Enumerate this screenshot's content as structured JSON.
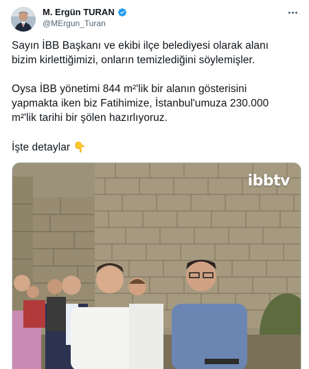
{
  "author": {
    "display_name": "M. Ergün TURAN",
    "handle": "@MErgun_Turan",
    "verified": true,
    "avatar_icon": "avatar-photo"
  },
  "tweet": {
    "line1": "Sayın İBB Başkanı ve ekibi ilçe belediyesi olarak alanı",
    "line2": "bizim kirlettiğimizi, onların temizlediğini söylemişler.",
    "line3": "Oysa İBB yönetimi 844 m²'lik bir alanın gösterisini",
    "line4": "yapmakta iken biz Fatihimize, İstanbul'umuza 230.000",
    "line5": "m²'lik tarihi bir şölen hazırlıyoruz.",
    "line6": "İşte detaylar",
    "emoji": "👇"
  },
  "media": {
    "type": "video",
    "watermark": "ibbtv"
  },
  "colors": {
    "verified": "#1d9bf0",
    "text": "#0f1419",
    "secondary": "#536471"
  },
  "icons": [
    "verified-badge-icon",
    "more-options-icon",
    "pointing-down-emoji"
  ]
}
